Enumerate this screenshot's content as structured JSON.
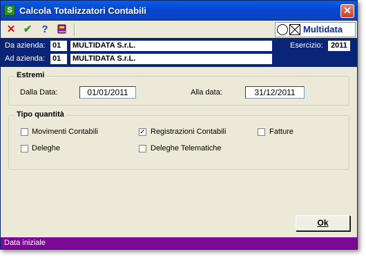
{
  "window": {
    "title": "Calcola Totalizzatori Contabili"
  },
  "toolbar": {
    "cancel_icon": "x-icon",
    "confirm_icon": "check-icon",
    "help_icon": "question-icon",
    "book_icon": "book-icon",
    "logo_text": "Multidata"
  },
  "info": {
    "da_label": "Da azienda:",
    "da_code": "01",
    "da_name": "MULTIDATA S.r.L.",
    "ad_label": "Ad azienda:",
    "ad_code": "01",
    "ad_name": "MULTIDATA S.r.L.",
    "esercizio_label": "Esercizio:",
    "esercizio_value": "2011"
  },
  "estremi": {
    "legend": "Estremi",
    "dalla_label": "Dalla Data:",
    "dalla_value": "01/01/2011",
    "alla_label": "Alla data:",
    "alla_value": "31/12/2011"
  },
  "tipo": {
    "legend": "Tipo quantità",
    "options": [
      {
        "label": "Movimenti Contabili",
        "checked": false
      },
      {
        "label": "Registrazioni Contabili",
        "checked": true
      },
      {
        "label": "Fatture",
        "checked": false
      },
      {
        "label": "Deleghe",
        "checked": false
      },
      {
        "label": "Deleghe Telematiche",
        "checked": false
      }
    ]
  },
  "buttons": {
    "ok": "Ok"
  },
  "status": {
    "text": "Data iniziale"
  },
  "colors": {
    "titlebar": "#0548d0",
    "infobar": "#0a2478",
    "statusbar": "#7a0a96",
    "window_bg": "#ece9d8"
  }
}
